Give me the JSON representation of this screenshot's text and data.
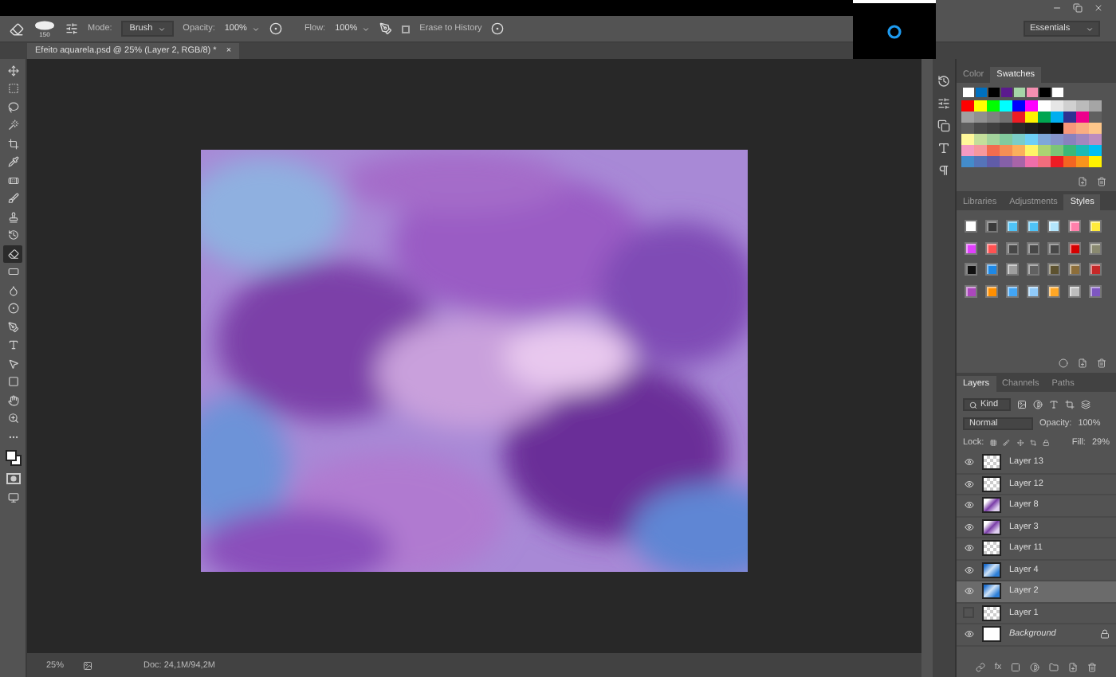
{
  "window_controls": [
    {
      "kind": "minimize"
    },
    {
      "kind": "restore"
    },
    {
      "kind": "close"
    }
  ],
  "assistant_popup": {
    "kind": "spinner"
  },
  "options_bar": {
    "brush_size": "150",
    "mode_label": "Mode:",
    "mode": "Brush",
    "opacity_label": "Opacity:",
    "opacity": "100%",
    "flow_label": "Flow:",
    "flow": "100%",
    "erase_to_history": {
      "label": "Erase to History",
      "checked": false
    },
    "workspace": "Essentials"
  },
  "document_tab": {
    "title": "Efeito aquarela.psd @ 25% (Layer 2, RGB/8) *",
    "close": "×"
  },
  "tools": [
    {
      "kind": "move",
      "selected": false
    },
    {
      "kind": "marquee",
      "selected": false
    },
    {
      "kind": "lasso",
      "selected": false
    },
    {
      "kind": "quick-selection",
      "selected": false
    },
    {
      "kind": "crop",
      "selected": false
    },
    {
      "kind": "eyedropper",
      "selected": false
    },
    {
      "kind": "healing",
      "selected": false
    },
    {
      "kind": "brush",
      "selected": false
    },
    {
      "kind": "stamp",
      "selected": false
    },
    {
      "kind": "history-brush",
      "selected": false
    },
    {
      "kind": "eraser",
      "selected": true
    },
    {
      "kind": "gradient",
      "selected": false
    },
    {
      "kind": "blur",
      "selected": false
    },
    {
      "kind": "dodge",
      "selected": false
    },
    {
      "kind": "pen",
      "selected": false
    },
    {
      "kind": "type",
      "selected": false
    },
    {
      "kind": "path-selection",
      "selected": false
    },
    {
      "kind": "shape",
      "selected": false
    },
    {
      "kind": "hand",
      "selected": false
    },
    {
      "kind": "zoom",
      "selected": false
    },
    {
      "kind": "more",
      "selected": false
    },
    {
      "kind": "colors",
      "selected": false
    },
    {
      "kind": "quick-mask",
      "selected": false
    },
    {
      "kind": "screen-mode",
      "selected": false
    }
  ],
  "status_bar": {
    "zoom": "25%",
    "doc_size": "Doc: 24,1M/94,2M"
  },
  "swatches_panel": {
    "tabs": [
      {
        "label": "Color",
        "selected": false
      },
      {
        "label": "Swatches",
        "selected": true
      }
    ],
    "recent": [
      {
        "color": "#ffffff"
      },
      {
        "color": "#0070c0"
      },
      {
        "color": "#000000"
      },
      {
        "color": "#5b1a8e"
      },
      {
        "color": "#a5d6a7"
      },
      {
        "color": "#f48fb1"
      },
      {
        "color": "#000000"
      },
      {
        "color": "#ffffff"
      }
    ],
    "rows": [
      {
        "swatches": [
          {
            "color": "#ff0000"
          },
          {
            "color": "#ffff00"
          },
          {
            "color": "#00ff00"
          },
          {
            "color": "#00ffff"
          },
          {
            "color": "#0000ff"
          },
          {
            "color": "#ff00ff"
          },
          {
            "color": "#ffffff"
          },
          {
            "color": "#e6e6e6"
          },
          {
            "color": "#d0d0d0"
          },
          {
            "color": "#bbbbbb"
          },
          {
            "color": "#a5a5a5"
          }
        ]
      },
      {
        "swatches": [
          {
            "color": "#a0a0a0"
          },
          {
            "color": "#909090"
          },
          {
            "color": "#808080"
          },
          {
            "color": "#707070"
          },
          {
            "color": "#ed1c24"
          },
          {
            "color": "#fff200"
          },
          {
            "color": "#00a651"
          },
          {
            "color": "#00aeef"
          },
          {
            "color": "#2e3192"
          },
          {
            "color": "#ec008c"
          },
          {
            "color": "#606060"
          }
        ]
      },
      {
        "swatches": [
          {
            "color": "#5e5e5e"
          },
          {
            "color": "#4a4a4a"
          },
          {
            "color": "#404040"
          },
          {
            "color": "#353535"
          },
          {
            "color": "#2a2a2a"
          },
          {
            "color": "#1f1f1f"
          },
          {
            "color": "#141414"
          },
          {
            "color": "#000000"
          },
          {
            "color": "#f7977a"
          },
          {
            "color": "#f9ad81"
          },
          {
            "color": "#fdc68a"
          }
        ]
      },
      {
        "swatches": [
          {
            "color": "#fff79a"
          },
          {
            "color": "#c4df9b"
          },
          {
            "color": "#a3d39c"
          },
          {
            "color": "#82ca9d"
          },
          {
            "color": "#7bcdc8"
          },
          {
            "color": "#6ecff6"
          },
          {
            "color": "#7ea7d8"
          },
          {
            "color": "#8493ca"
          },
          {
            "color": "#8882be"
          },
          {
            "color": "#a187be"
          },
          {
            "color": "#bc8dbf"
          }
        ]
      },
      {
        "swatches": [
          {
            "color": "#f49ac2"
          },
          {
            "color": "#f6989d"
          },
          {
            "color": "#f26c4f"
          },
          {
            "color": "#f68e55"
          },
          {
            "color": "#fbaf5c"
          },
          {
            "color": "#fff467"
          },
          {
            "color": "#acd372"
          },
          {
            "color": "#7cc576"
          },
          {
            "color": "#3bb878"
          },
          {
            "color": "#1abbb4"
          },
          {
            "color": "#00bff3"
          }
        ]
      },
      {
        "swatches": [
          {
            "color": "#438ccb"
          },
          {
            "color": "#5574b9"
          },
          {
            "color": "#605ca8"
          },
          {
            "color": "#8560a8"
          },
          {
            "color": "#a864a8"
          },
          {
            "color": "#f06eaa"
          },
          {
            "color": "#f26d7d"
          },
          {
            "color": "#ed1c24"
          },
          {
            "color": "#f26522"
          },
          {
            "color": "#f7941d"
          },
          {
            "color": "#fff200"
          }
        ]
      }
    ]
  },
  "styles_panel": {
    "tabs": [
      {
        "label": "Libraries",
        "selected": false
      },
      {
        "label": "Adjustments",
        "selected": false
      },
      {
        "label": "Styles",
        "selected": true
      }
    ],
    "styles": [
      {
        "color": "#ffffff"
      },
      {
        "color": "#3a3a3a"
      },
      {
        "color": "#4fc3f7"
      },
      {
        "color": "#4fc3f7"
      },
      {
        "color": "#b3e5fc"
      },
      {
        "color": "#ff80ab"
      },
      {
        "color": "#ffeb3b"
      },
      {
        "color": "#e040fb"
      },
      {
        "color": "#ff5252"
      },
      {
        "color": "#474747"
      },
      {
        "color": "#474747"
      },
      {
        "color": "#474747"
      },
      {
        "color": "#d50000"
      },
      {
        "color": "#8a8a70"
      },
      {
        "color": "#111111"
      },
      {
        "color": "#1e88e5"
      },
      {
        "color": "#9e9e9e"
      },
      {
        "color": "#616161"
      },
      {
        "color": "#5d5230"
      },
      {
        "color": "#8d6e3a"
      },
      {
        "color": "#c62828"
      },
      {
        "color": "#ab47bc"
      },
      {
        "color": "#ff8f00"
      },
      {
        "color": "#42a5f5"
      },
      {
        "color": "#90caf9"
      },
      {
        "color": "#ffa726"
      },
      {
        "color": "#bdbdbd"
      },
      {
        "color": "#7e57c2"
      }
    ]
  },
  "layers_panel": {
    "tabs": [
      {
        "label": "Layers",
        "selected": true
      },
      {
        "label": "Channels",
        "selected": false
      },
      {
        "label": "Paths",
        "selected": false
      }
    ],
    "filter": "Kind",
    "blend_mode": "Normal",
    "opacity_label": "Opacity:",
    "opacity": "100%",
    "lock_label": "Lock:",
    "fill_label": "Fill:",
    "fill": "29%",
    "effects_label": "fx",
    "layers": [
      {
        "name": "Layer 13",
        "kind": "layer",
        "visible": true,
        "selected": false,
        "thumbnail": {
          "kind": "transparent"
        }
      },
      {
        "name": "Layer 12",
        "kind": "layer",
        "visible": true,
        "selected": false,
        "thumbnail": {
          "kind": "transparent"
        }
      },
      {
        "name": "Layer 8",
        "kind": "layer",
        "visible": true,
        "selected": false,
        "thumbnail": {
          "kind": "purple"
        }
      },
      {
        "name": "Layer 3",
        "kind": "layer",
        "visible": true,
        "selected": false,
        "thumbnail": {
          "kind": "purple"
        }
      },
      {
        "name": "Layer 11",
        "kind": "layer",
        "visible": true,
        "selected": false,
        "thumbnail": {
          "kind": "transparent"
        }
      },
      {
        "name": "Layer 4",
        "kind": "layer",
        "visible": true,
        "selected": false,
        "thumbnail": {
          "kind": "blue"
        }
      },
      {
        "name": "Layer 2",
        "kind": "layer",
        "visible": true,
        "selected": true,
        "thumbnail": {
          "kind": "blue"
        }
      },
      {
        "name": "Layer 1",
        "kind": "layer",
        "visible": false,
        "selected": false,
        "thumbnail": {
          "kind": "transparent"
        }
      },
      {
        "name": "Background",
        "kind": "background",
        "visible": true,
        "selected": false,
        "thumbnail": {
          "kind": "white"
        }
      }
    ]
  }
}
